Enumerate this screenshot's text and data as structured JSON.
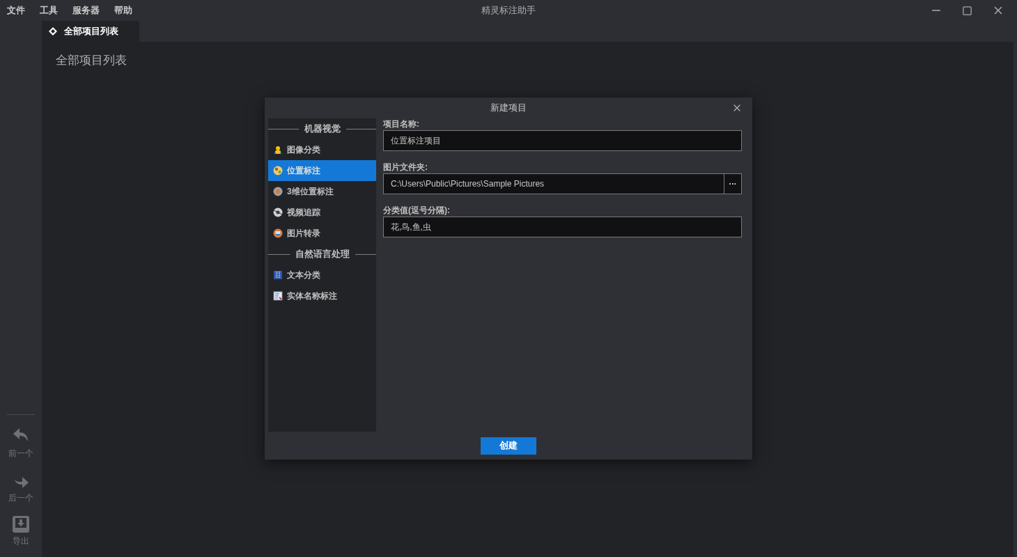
{
  "menu": [
    "文件",
    "工具",
    "服务器",
    "帮助"
  ],
  "window": {
    "title": "精灵标注助手"
  },
  "tabs": [
    {
      "label": "全部项目列表",
      "selected": true
    }
  ],
  "page_title": "全部项目列表",
  "sidebar": {
    "items": [
      {
        "label": "前一个"
      },
      {
        "label": "后一个"
      },
      {
        "label": "导出"
      }
    ]
  },
  "dialog": {
    "title": "新建项目",
    "categories": [
      {
        "label": "机器视觉",
        "items": [
          {
            "label": "图像分类",
            "selected": false
          },
          {
            "label": "位置标注",
            "selected": true
          },
          {
            "label": "3维位置标注",
            "selected": false
          },
          {
            "label": "视频追踪",
            "selected": false
          },
          {
            "label": "图片转录",
            "selected": false
          }
        ]
      },
      {
        "label": "自然语言处理",
        "items": [
          {
            "label": "文本分类",
            "selected": false
          },
          {
            "label": "实体名称标注",
            "selected": false
          }
        ]
      }
    ],
    "fields": [
      {
        "label": "项目名称:",
        "value": "位置标注项目",
        "kind": "text"
      },
      {
        "label": "图片文件夹:",
        "value": "C:\\Users\\Public\\Pictures\\Sample Pictures",
        "kind": "folder",
        "browse": "···"
      },
      {
        "label": "分类值(逗号分隔):",
        "value": "花,鸟,鱼,虫",
        "kind": "text"
      }
    ],
    "submit": "创建"
  }
}
